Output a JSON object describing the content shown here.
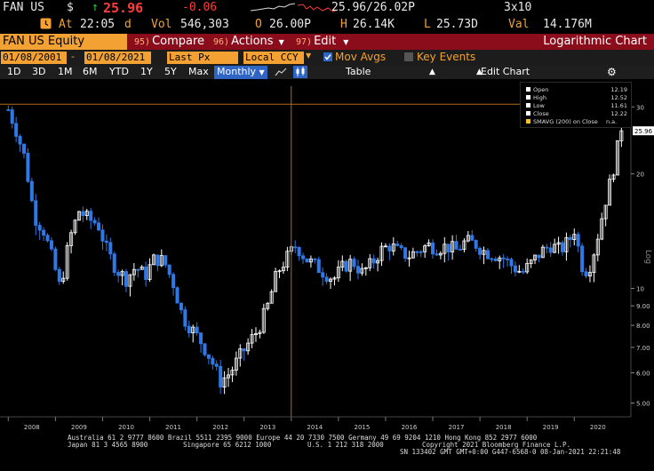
{
  "quote": {
    "ticker": "FAN US",
    "currency": "$",
    "arrow": "↑",
    "last": "25.96",
    "change": "-0.06",
    "at_label": "At",
    "time": "22:05",
    "time_suffix": "d",
    "vol_label": "Vol",
    "volume": "546,303",
    "open_label": "O",
    "open": "26.00P",
    "bidask_label": "P",
    "bidask": "25.96/26.02P",
    "size": "3x10",
    "high_label": "H",
    "high": "26.14K",
    "low_label": "L",
    "low": "25.73D",
    "val_label": "Val",
    "val": "14.176M"
  },
  "titlebar": {
    "security": "FAN US Equity",
    "menu": [
      {
        "num": "95)",
        "label": "Compare"
      },
      {
        "num": "96)",
        "label": "Actions"
      },
      {
        "num": "97)",
        "label": "Edit"
      }
    ],
    "title": "Logarithmic Chart"
  },
  "params": {
    "start_date": "01/08/2001",
    "end_date": "01/08/2021",
    "field": "Last Px",
    "currency": "Local CCY",
    "mov_avgs_label": "Mov Avgs",
    "key_events_label": "Key Events"
  },
  "toolbar": {
    "ranges": [
      "1D",
      "3D",
      "1M",
      "6M",
      "YTD",
      "1Y",
      "5Y",
      "Max"
    ],
    "period": "Monthly",
    "table_label": "Table",
    "edit_chart_label": "Edit Chart"
  },
  "legend": {
    "items": [
      {
        "label": "Open",
        "value": "12.19",
        "color": "#ffffff"
      },
      {
        "label": "High",
        "value": "12.52",
        "color": "#ffffff"
      },
      {
        "label": "Low",
        "value": "11.61",
        "color": "#ffffff"
      },
      {
        "label": "Close",
        "value": "12.22",
        "color": "#ffffff"
      },
      {
        "label": "SMAVG (200)  on Close",
        "value": "n.a.",
        "color": "#f3c32f"
      }
    ]
  },
  "chart_data": {
    "type": "candlestick",
    "scale": "log",
    "ylabel": "Log",
    "ylim": [
      4.6,
      34
    ],
    "y_ticks": [
      "30",
      "20",
      "10",
      "9.00",
      "8.00",
      "7.00",
      "6.00",
      "5.00"
    ],
    "x_ticks": [
      "2008",
      "2009",
      "2010",
      "2011",
      "2012",
      "2013",
      "2014",
      "2015",
      "2016",
      "2017",
      "2018",
      "2019",
      "2020"
    ],
    "last_price_label": "25.96",
    "last_price": 25.96,
    "crosshair_value": 30.5,
    "crosshair_date": "2014-01",
    "closes": [
      [
        2008.0,
        29.5
      ],
      [
        2008.15,
        26.5
      ],
      [
        2008.35,
        22.0
      ],
      [
        2008.55,
        15.5
      ],
      [
        2008.75,
        14.2
      ],
      [
        2008.95,
        11.8
      ],
      [
        2009.1,
        10.0
      ],
      [
        2009.3,
        13.5
      ],
      [
        2009.5,
        16.0
      ],
      [
        2009.7,
        15.2
      ],
      [
        2009.9,
        14.8
      ],
      [
        2010.1,
        12.5
      ],
      [
        2010.3,
        11.2
      ],
      [
        2010.5,
        10.6
      ],
      [
        2010.7,
        11.4
      ],
      [
        2010.9,
        10.8
      ],
      [
        2011.1,
        12.0
      ],
      [
        2011.3,
        11.8
      ],
      [
        2011.5,
        10.3
      ],
      [
        2011.7,
        8.4
      ],
      [
        2011.9,
        7.8
      ],
      [
        2012.1,
        7.2
      ],
      [
        2012.3,
        6.5
      ],
      [
        2012.5,
        5.7
      ],
      [
        2012.7,
        6.0
      ],
      [
        2012.9,
        6.6
      ],
      [
        2013.1,
        7.2
      ],
      [
        2013.3,
        7.8
      ],
      [
        2013.5,
        9.0
      ],
      [
        2013.7,
        11.0
      ],
      [
        2013.9,
        12.0
      ],
      [
        2014.1,
        13.0
      ],
      [
        2014.3,
        12.0
      ],
      [
        2014.5,
        11.5
      ],
      [
        2014.7,
        11.0
      ],
      [
        2014.9,
        10.6
      ],
      [
        2015.1,
        11.4
      ],
      [
        2015.3,
        11.8
      ],
      [
        2015.5,
        11.0
      ],
      [
        2015.7,
        11.6
      ],
      [
        2015.9,
        12.6
      ],
      [
        2016.1,
        13.0
      ],
      [
        2016.3,
        12.4
      ],
      [
        2016.5,
        12.2
      ],
      [
        2016.7,
        12.6
      ],
      [
        2016.9,
        13.0
      ],
      [
        2017.1,
        12.8
      ],
      [
        2017.3,
        12.9
      ],
      [
        2017.5,
        12.6
      ],
      [
        2017.7,
        13.3
      ],
      [
        2017.9,
        13.1
      ],
      [
        2018.1,
        12.5
      ],
      [
        2018.3,
        12.3
      ],
      [
        2018.5,
        12.0
      ],
      [
        2018.7,
        11.4
      ],
      [
        2018.9,
        11.0
      ],
      [
        2019.1,
        11.7
      ],
      [
        2019.3,
        12.5
      ],
      [
        2019.5,
        13.0
      ],
      [
        2019.7,
        12.6
      ],
      [
        2019.9,
        13.4
      ],
      [
        2020.0,
        14.3
      ],
      [
        2020.2,
        11.0
      ],
      [
        2020.35,
        11.6
      ],
      [
        2020.5,
        13.8
      ],
      [
        2020.65,
        16.8
      ],
      [
        2020.8,
        19.8
      ],
      [
        2020.92,
        23.5
      ],
      [
        2021.0,
        25.96
      ]
    ]
  },
  "footer": {
    "line1": "Australia 61 2 9777 8600 Brazil 5511 2395 9000 Europe 44 20 7330 7500 Germany 49 69 9204 1210 Hong Kong 852 2977 6000",
    "line2a": "Japan 81 3 4565 8900",
    "line2b": "Singapore 65 6212 1000",
    "line2c": "U.S. 1 212 318 2000",
    "line2d": "Copyright 2021 Bloomberg Finance L.P.",
    "line3": "SN 133402 GMT  GMT+0:00 G447-6568-0 08-Jan-2021 22:21:48"
  },
  "colors": {
    "orange": "#f3a132",
    "bar_red": "#8b0d1b",
    "up_candle": "#ffffff",
    "down_candle": "#2f78e6",
    "crosshair": "#b36a17",
    "axis": "#444444"
  }
}
